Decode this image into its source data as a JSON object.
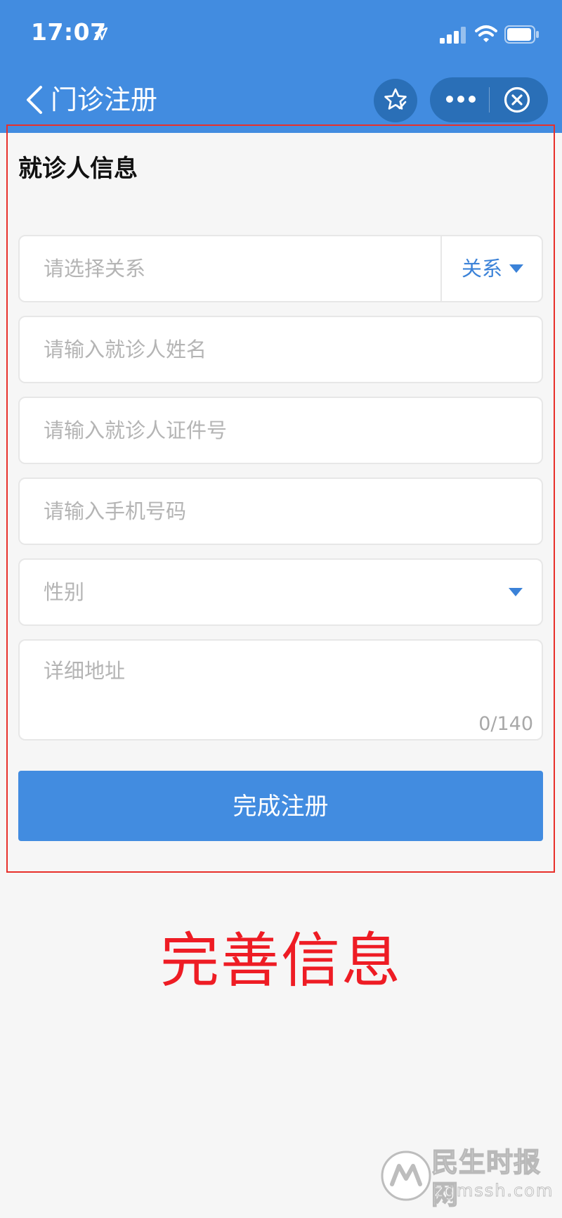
{
  "status_bar": {
    "time": "17:07"
  },
  "nav": {
    "title": "门诊注册"
  },
  "form": {
    "section_title": "就诊人信息",
    "relation": {
      "placeholder": "请选择关系",
      "button_label": "关系"
    },
    "name": {
      "placeholder": "请输入就诊人姓名"
    },
    "id_number": {
      "placeholder": "请输入就诊人证件号"
    },
    "phone": {
      "placeholder": "请输入手机号码"
    },
    "gender": {
      "placeholder": "性别"
    },
    "address": {
      "placeholder": "详细地址",
      "counter": "0/140"
    },
    "submit_label": "完成注册"
  },
  "annotation": {
    "caption": "完善信息"
  },
  "watermark": {
    "name": "民生时报网",
    "url": "zgmssh.com"
  },
  "colors": {
    "primary": "#428ce0",
    "primary_dark": "#2a6fb7",
    "annotation_red": "#ee1c24",
    "placeholder_gray": "#b4b4b4",
    "background": "#f6f6f6"
  },
  "icons": {
    "back": "chevron-left-icon",
    "favorite": "star-icon",
    "more": "more-dots-icon",
    "close": "close-circle-icon",
    "dropdown": "caret-down-icon"
  }
}
